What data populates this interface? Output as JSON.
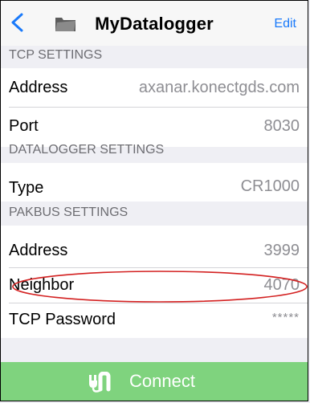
{
  "nav": {
    "title": "MyDatalogger",
    "edit_label": "Edit",
    "back_icon": "chevron-left-icon",
    "folder_icon": "folder-icon"
  },
  "sections": {
    "tcp": {
      "header": "TCP SETTINGS",
      "rows": [
        {
          "label": "Address",
          "value": "axanar.konectgds.com"
        },
        {
          "label": "Port",
          "value": "8030"
        }
      ]
    },
    "datalogger": {
      "header": "DATALOGGER SETTINGS",
      "rows": [
        {
          "label": "Type",
          "value": "CR1000"
        }
      ]
    },
    "pakbus": {
      "header": "PAKBUS SETTINGS",
      "rows": [
        {
          "label": "Address",
          "value": "3999"
        },
        {
          "label": "Neighbor",
          "value": "4070"
        },
        {
          "label": "TCP Password",
          "value": "*****"
        }
      ]
    }
  },
  "connect": {
    "label": "Connect",
    "icon": "plug-icon"
  },
  "colors": {
    "accent": "#1a7afa",
    "connect_bg": "#7fd37e",
    "annotation": "#d32020",
    "secondary_text": "#8e8e93",
    "header_text": "#6d6d72"
  }
}
